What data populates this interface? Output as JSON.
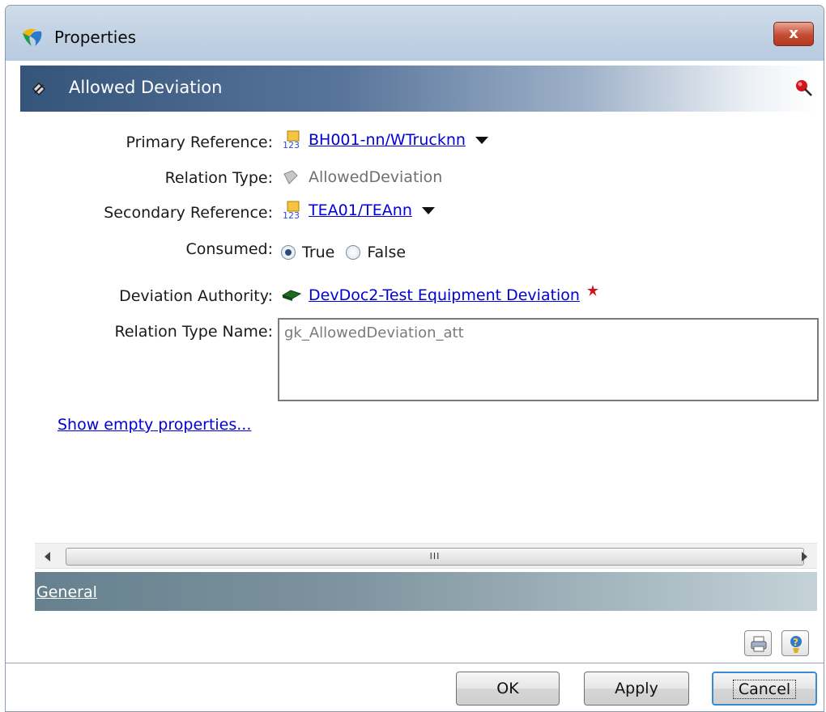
{
  "window": {
    "title": "Properties",
    "close_label": "x"
  },
  "header": {
    "title": "Allowed Deviation"
  },
  "fields": {
    "primary_reference": {
      "label": "Primary Reference:",
      "value": "BH001-nn/WTrucknn"
    },
    "relation_type": {
      "label": "Relation Type:",
      "value": "AllowedDeviation"
    },
    "secondary_reference": {
      "label": "Secondary Reference:",
      "value": "TEA01/TEAnn"
    },
    "consumed": {
      "label": "Consumed:",
      "options": [
        "True",
        "False"
      ],
      "selected": "True"
    },
    "deviation_authority": {
      "label": "Deviation Authority:",
      "value": "DevDoc2-Test Equipment Deviation"
    },
    "relation_type_name": {
      "label": "Relation Type Name:",
      "value": "gk_AllowedDeviation_att"
    }
  },
  "show_empty_link": "Show empty properties...",
  "scrollbar": {
    "thumb_grip": "III"
  },
  "tabs": [
    {
      "label": "General"
    }
  ],
  "buttons": {
    "ok": "OK",
    "apply": "Apply",
    "cancel": "Cancel"
  },
  "icons": {
    "app": "teamcenter-app-icon",
    "header": "diamond-pencil-icon",
    "pin": "red-pin-icon",
    "item": "item-revision-icon",
    "relation": "relation-icon",
    "document": "document-green-icon",
    "required": "required-asterisk-icon",
    "print": "print-icon",
    "help": "help-icon"
  }
}
